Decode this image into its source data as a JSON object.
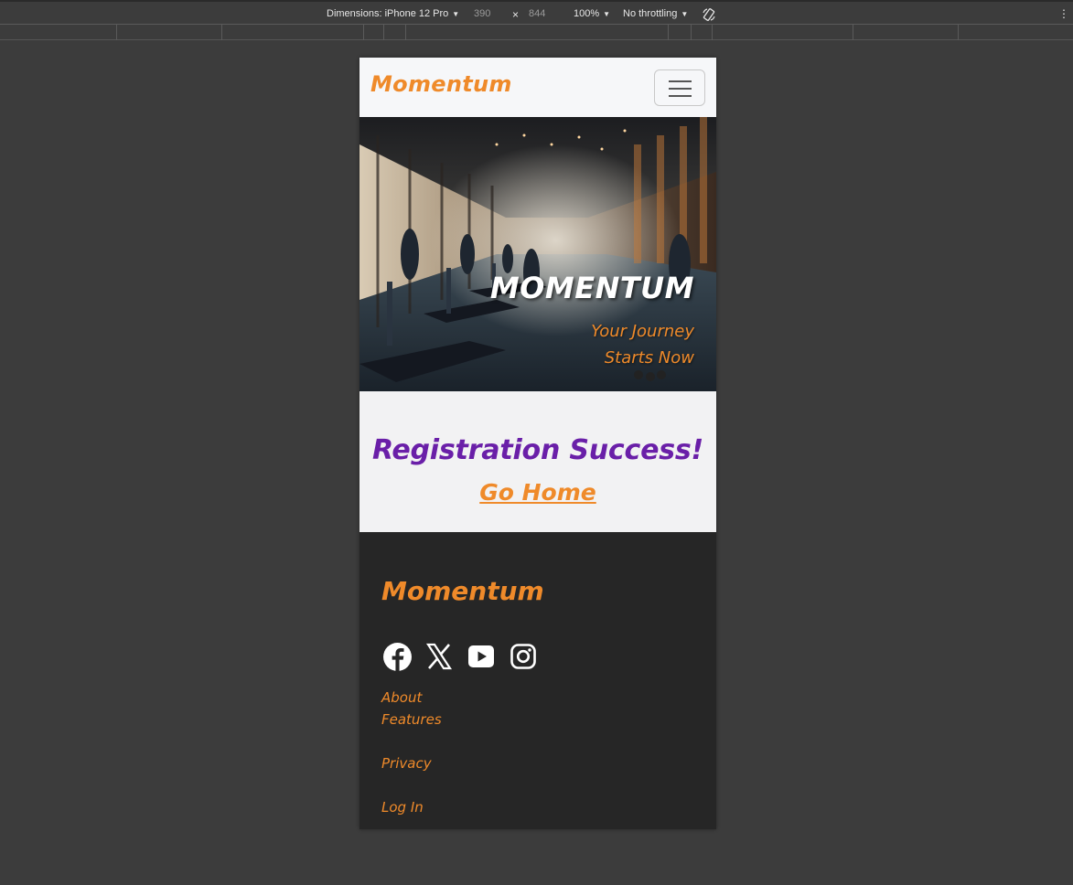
{
  "devtools": {
    "dimensions_label": "Dimensions: iPhone 12 Pro",
    "width": "390",
    "height": "844",
    "times": "×",
    "zoom": "100%",
    "throttling": "No throttling"
  },
  "navbar": {
    "brand": "Momentum"
  },
  "hero": {
    "title": "MOMENTUM",
    "subtitle": "Your Journey Starts Now"
  },
  "main": {
    "heading": "Registration Success!",
    "link": "Go Home"
  },
  "footer": {
    "brand": "Momentum",
    "social_icons": [
      "facebook-icon",
      "x-icon",
      "youtube-icon",
      "instagram-icon"
    ],
    "links": [
      "About",
      "Features",
      "Privacy",
      "Log In"
    ]
  },
  "colors": {
    "accent_orange": "#ef8a2a",
    "heading_purple": "#6a1fa8",
    "footer_bg": "#262626",
    "page_bg": "#3c3c3c"
  }
}
